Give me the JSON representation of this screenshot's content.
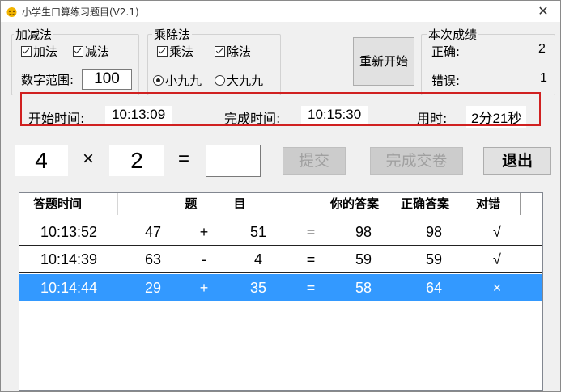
{
  "window": {
    "title": "小学生口算练习题目(V2.1)",
    "close_glyph": "✕"
  },
  "add_sub_group": {
    "title": "加减法",
    "add_label": "加法",
    "sub_label": "减法",
    "range_label": "数字范围:",
    "range_value": "100"
  },
  "mul_div_group": {
    "title": "乘除法",
    "mul_label": "乘法",
    "div_label": "除法",
    "small_table_label": "小九九",
    "big_table_label": "大九九"
  },
  "restart_label": "重新开始",
  "score_group": {
    "title": "本次成绩",
    "correct_label": "正确:",
    "correct_value": "2",
    "wrong_label": "错误:",
    "wrong_value": "1"
  },
  "timing": {
    "start_label": "开始时间:",
    "start_value": "10:13:09",
    "finish_label": "完成时间:",
    "finish_value": "10:15:30",
    "used_label": "用时:",
    "used_value": "2分21秒"
  },
  "question": {
    "operand1": "4",
    "operator": "×",
    "operand2": "2",
    "equals": "=",
    "answer": ""
  },
  "buttons": {
    "submit": "提交",
    "finish": "完成交卷",
    "exit": "退出"
  },
  "table": {
    "headers": {
      "time": "答题时间",
      "question": "题 目",
      "your_answer": "你的答案",
      "correct_answer": "正确答案",
      "result": "对错"
    },
    "rows": [
      {
        "time": "10:13:52",
        "a": "47",
        "op": "+",
        "b": "51",
        "eq": "=",
        "yours": "98",
        "correct": "98",
        "mark": "√"
      },
      {
        "time": "10:14:39",
        "a": "63",
        "op": "-",
        "b": "4",
        "eq": "=",
        "yours": "59",
        "correct": "59",
        "mark": "√"
      },
      {
        "time": "10:14:44",
        "a": "29",
        "op": "+",
        "b": "35",
        "eq": "=",
        "yours": "58",
        "correct": "64",
        "mark": "×"
      }
    ]
  },
  "colors": {
    "selection": "#3399ff",
    "highlight_frame": "#d02020",
    "app_icon": "#f2b400"
  }
}
